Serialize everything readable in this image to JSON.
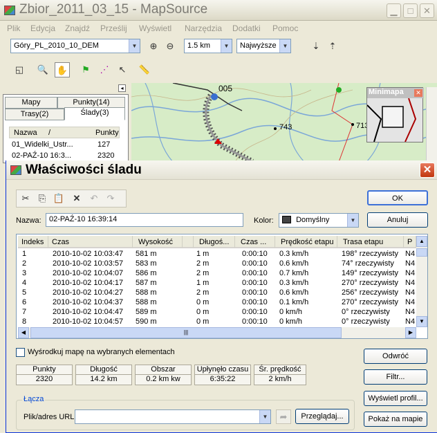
{
  "main_window": {
    "title": "Zbior_2011_03_15 - MapSource",
    "menu": [
      "Plik",
      "Edycja",
      "Znajdź",
      "Prześlij",
      "Wyświetl",
      "Narzędzia",
      "Dodatki",
      "Pomoc"
    ],
    "map_product": "Góry_PL_2010_10_DEM",
    "zoom_scale": "1.5 km",
    "detail_level": "Najwyższe"
  },
  "left_panel": {
    "tabs": [
      "Mapy",
      "Punkty(14)",
      "Trasy(2)",
      "Ślady(3)"
    ],
    "columns": [
      "Nazwa",
      "/",
      "Punkty"
    ],
    "rows": [
      {
        "name": "01_Widelki_Ustr...",
        "points": "127"
      },
      {
        "name": "02-PAŹ-10 16:3...",
        "points": "2320"
      }
    ]
  },
  "map": {
    "labels": [
      "005",
      "743",
      "713"
    ],
    "minimap_title": "Minimapa"
  },
  "dialog": {
    "title": "Właściwości śladu",
    "name_label": "Nazwa:",
    "name_value": "02-PAŹ-10 16:39:14",
    "color_label": "Kolor:",
    "color_value": "Domyślny",
    "ok_label": "OK",
    "cancel_label": "Anuluj",
    "columns": [
      "Indeks",
      "Czas",
      "Wysokość",
      "",
      "Długoś...",
      "Czas ...",
      "Prędkość etapu",
      "Trasa etapu",
      "P"
    ],
    "rows": [
      [
        "1",
        "2010-10-02 10:03:47",
        "581 m",
        "1 m",
        "0:00:10",
        "0.3 km/h",
        "198° rzeczywisty",
        "N4"
      ],
      [
        "2",
        "2010-10-02 10:03:57",
        "583 m",
        "2 m",
        "0:00:10",
        "0.6 km/h",
        "74° rzeczywisty",
        "N4"
      ],
      [
        "3",
        "2010-10-02 10:04:07",
        "586 m",
        "2 m",
        "0:00:10",
        "0.7 km/h",
        "149° rzeczywisty",
        "N4"
      ],
      [
        "4",
        "2010-10-02 10:04:17",
        "587 m",
        "1 m",
        "0:00:10",
        "0.3 km/h",
        "270° rzeczywisty",
        "N4"
      ],
      [
        "5",
        "2010-10-02 10:04:27",
        "588 m",
        "2 m",
        "0:00:10",
        "0.6 km/h",
        "256° rzeczywisty",
        "N4"
      ],
      [
        "6",
        "2010-10-02 10:04:37",
        "588 m",
        "0 m",
        "0:00:10",
        "0.1 km/h",
        "270° rzeczywisty",
        "N4"
      ],
      [
        "7",
        "2010-10-02 10:04:47",
        "589 m",
        "0 m",
        "0:00:10",
        "0 km/h",
        "0° rzeczywisty",
        "N4"
      ],
      [
        "8",
        "2010-10-02 10:04:57",
        "590 m",
        "0 m",
        "0:00:10",
        "0 km/h",
        "0° rzeczywisty",
        "N4"
      ]
    ],
    "center_map_label": "Wyśrodkuj mapę na wybranych elementach",
    "invert_label": "Odwróć",
    "filter_label": "Filtr...",
    "show_profile_label": "Wyświetl profil...",
    "show_on_map_label": "Pokaż na mapie",
    "stats": {
      "headers": [
        "Punkty",
        "Długość",
        "Obszar",
        "Upłynęło czasu",
        "Śr. prędkość"
      ],
      "values": [
        "2320",
        "14.2 km",
        "0.2 km kw",
        "6:35:22",
        "2 km/h"
      ]
    },
    "links_group_label": "Łącza",
    "url_label": "Plik/adres URL:",
    "url_value": "",
    "browse_label": "Przeglądaj..."
  },
  "colors": {
    "dialog_border": "#0831d9",
    "track_color": "#555555",
    "close_red": "#c1370f"
  }
}
